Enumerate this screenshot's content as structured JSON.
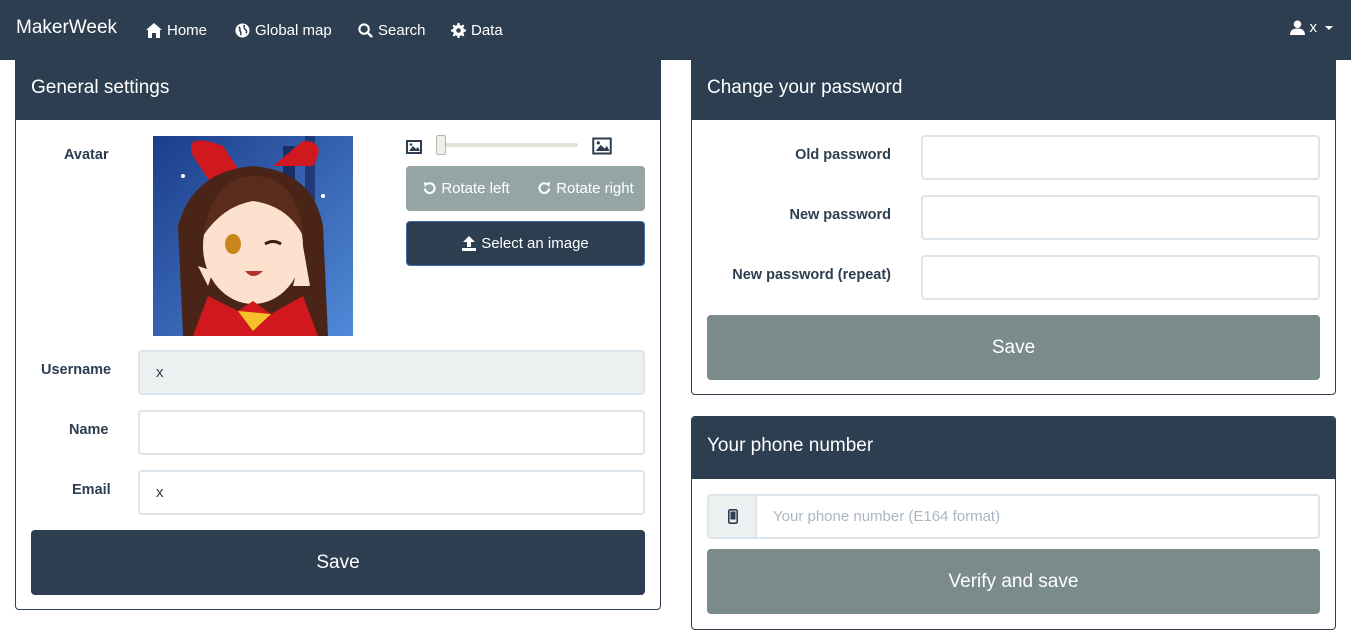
{
  "nav": {
    "brand": "MakerWeek",
    "items": [
      {
        "label": "Home",
        "icon": "home-icon"
      },
      {
        "label": "Global map",
        "icon": "globe-icon"
      },
      {
        "label": "Search",
        "icon": "search-icon"
      },
      {
        "label": "Data",
        "icon": "gear-icon"
      }
    ],
    "user": "x"
  },
  "general": {
    "title": "General settings",
    "avatar_label": "Avatar",
    "rotate_left": "Rotate left",
    "rotate_right": "Rotate right",
    "select_image": "Select an image",
    "zoom_level": 0.0,
    "username_label": "Username",
    "username_value": "x",
    "name_label": "Name",
    "name_value": "",
    "email_label": "Email",
    "email_value": "x",
    "save": "Save"
  },
  "password": {
    "title": "Change your password",
    "old_label": "Old password",
    "new_label": "New password",
    "repeat_label": "New password (repeat)",
    "save": "Save"
  },
  "phone": {
    "title": "Your phone number",
    "placeholder": "Your phone number (E164 format)",
    "verify": "Verify and save"
  },
  "colors": {
    "primary": "#2c3e50",
    "secondary": "#7b8a8b",
    "rotate_bg": "#95a5a6",
    "input_border": "#dce4ec",
    "disabled_bg": "#ecf0f1"
  }
}
